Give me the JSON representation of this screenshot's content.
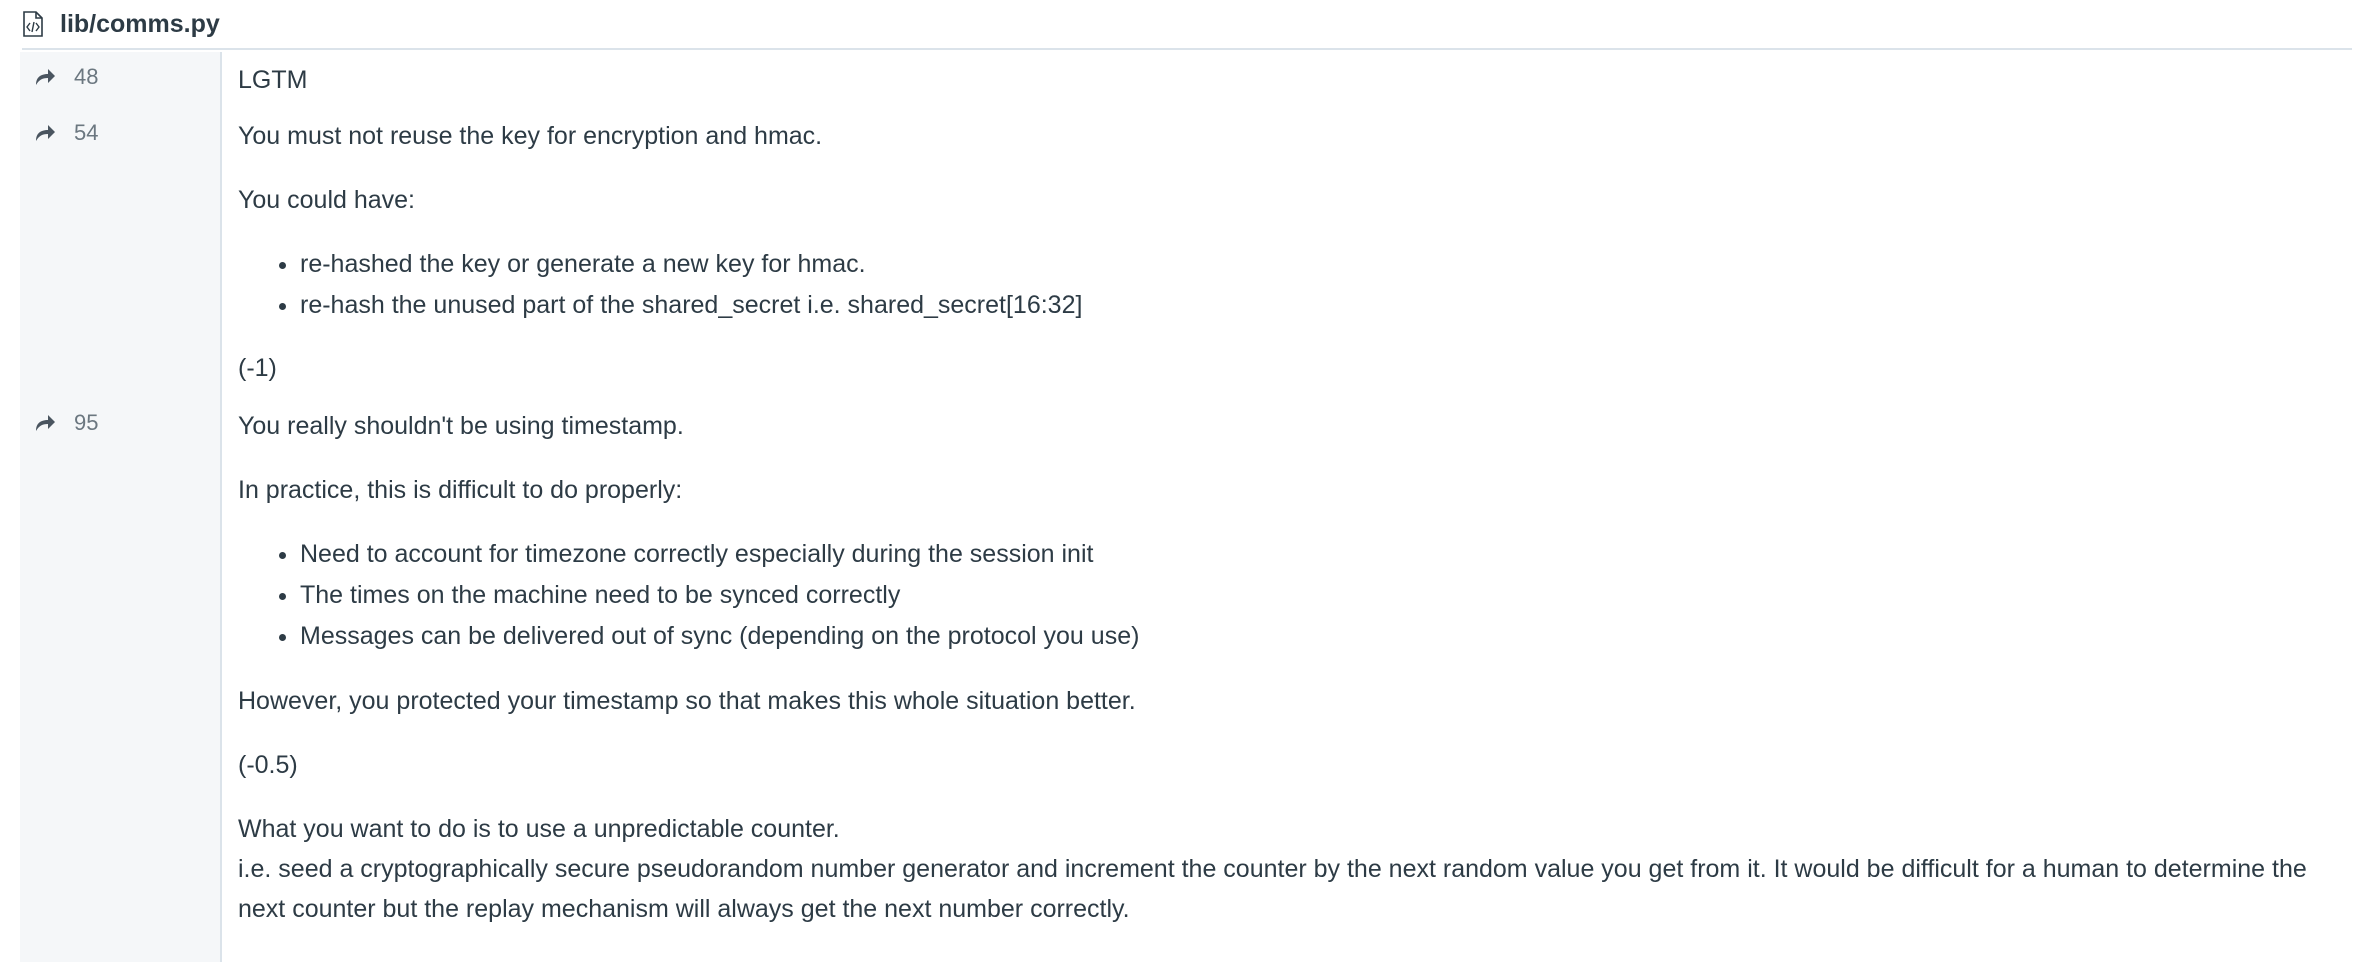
{
  "file": {
    "name": "lib/comms.py",
    "icon": "code-file-icon"
  },
  "comments": [
    {
      "line": "48",
      "text": "LGTM"
    },
    {
      "line": "54",
      "p1": "You must not reuse the key for encryption and hmac.",
      "p2": "You could have:",
      "bullets": [
        "re-hashed the key or generate a new key for hmac.",
        "re-hash the unused part of the shared_secret i.e. shared_secret[16:32]"
      ],
      "score": "(-1)"
    },
    {
      "line": "95",
      "p1": "You really shouldn't be using timestamp.",
      "p2": "In practice, this is difficult to do properly:",
      "bullets": [
        "Need to account for timezone correctly especially during the session init",
        "The times on the machine need to be synced correctly",
        "Messages can be delivered out of sync (depending on the protocol you use)"
      ],
      "p3": "However, you protected your timestamp so that makes this whole situation better.",
      "score": "(-0.5)",
      "p4": "What you want to do is to use a unpredictable counter.",
      "p5": "i.e. seed a cryptographically secure pseudorandom number generator and increment the counter by the next random value you get from it. It would be difficult for a human to determine the next counter but the replay mechanism will always get the next number correctly."
    }
  ]
}
